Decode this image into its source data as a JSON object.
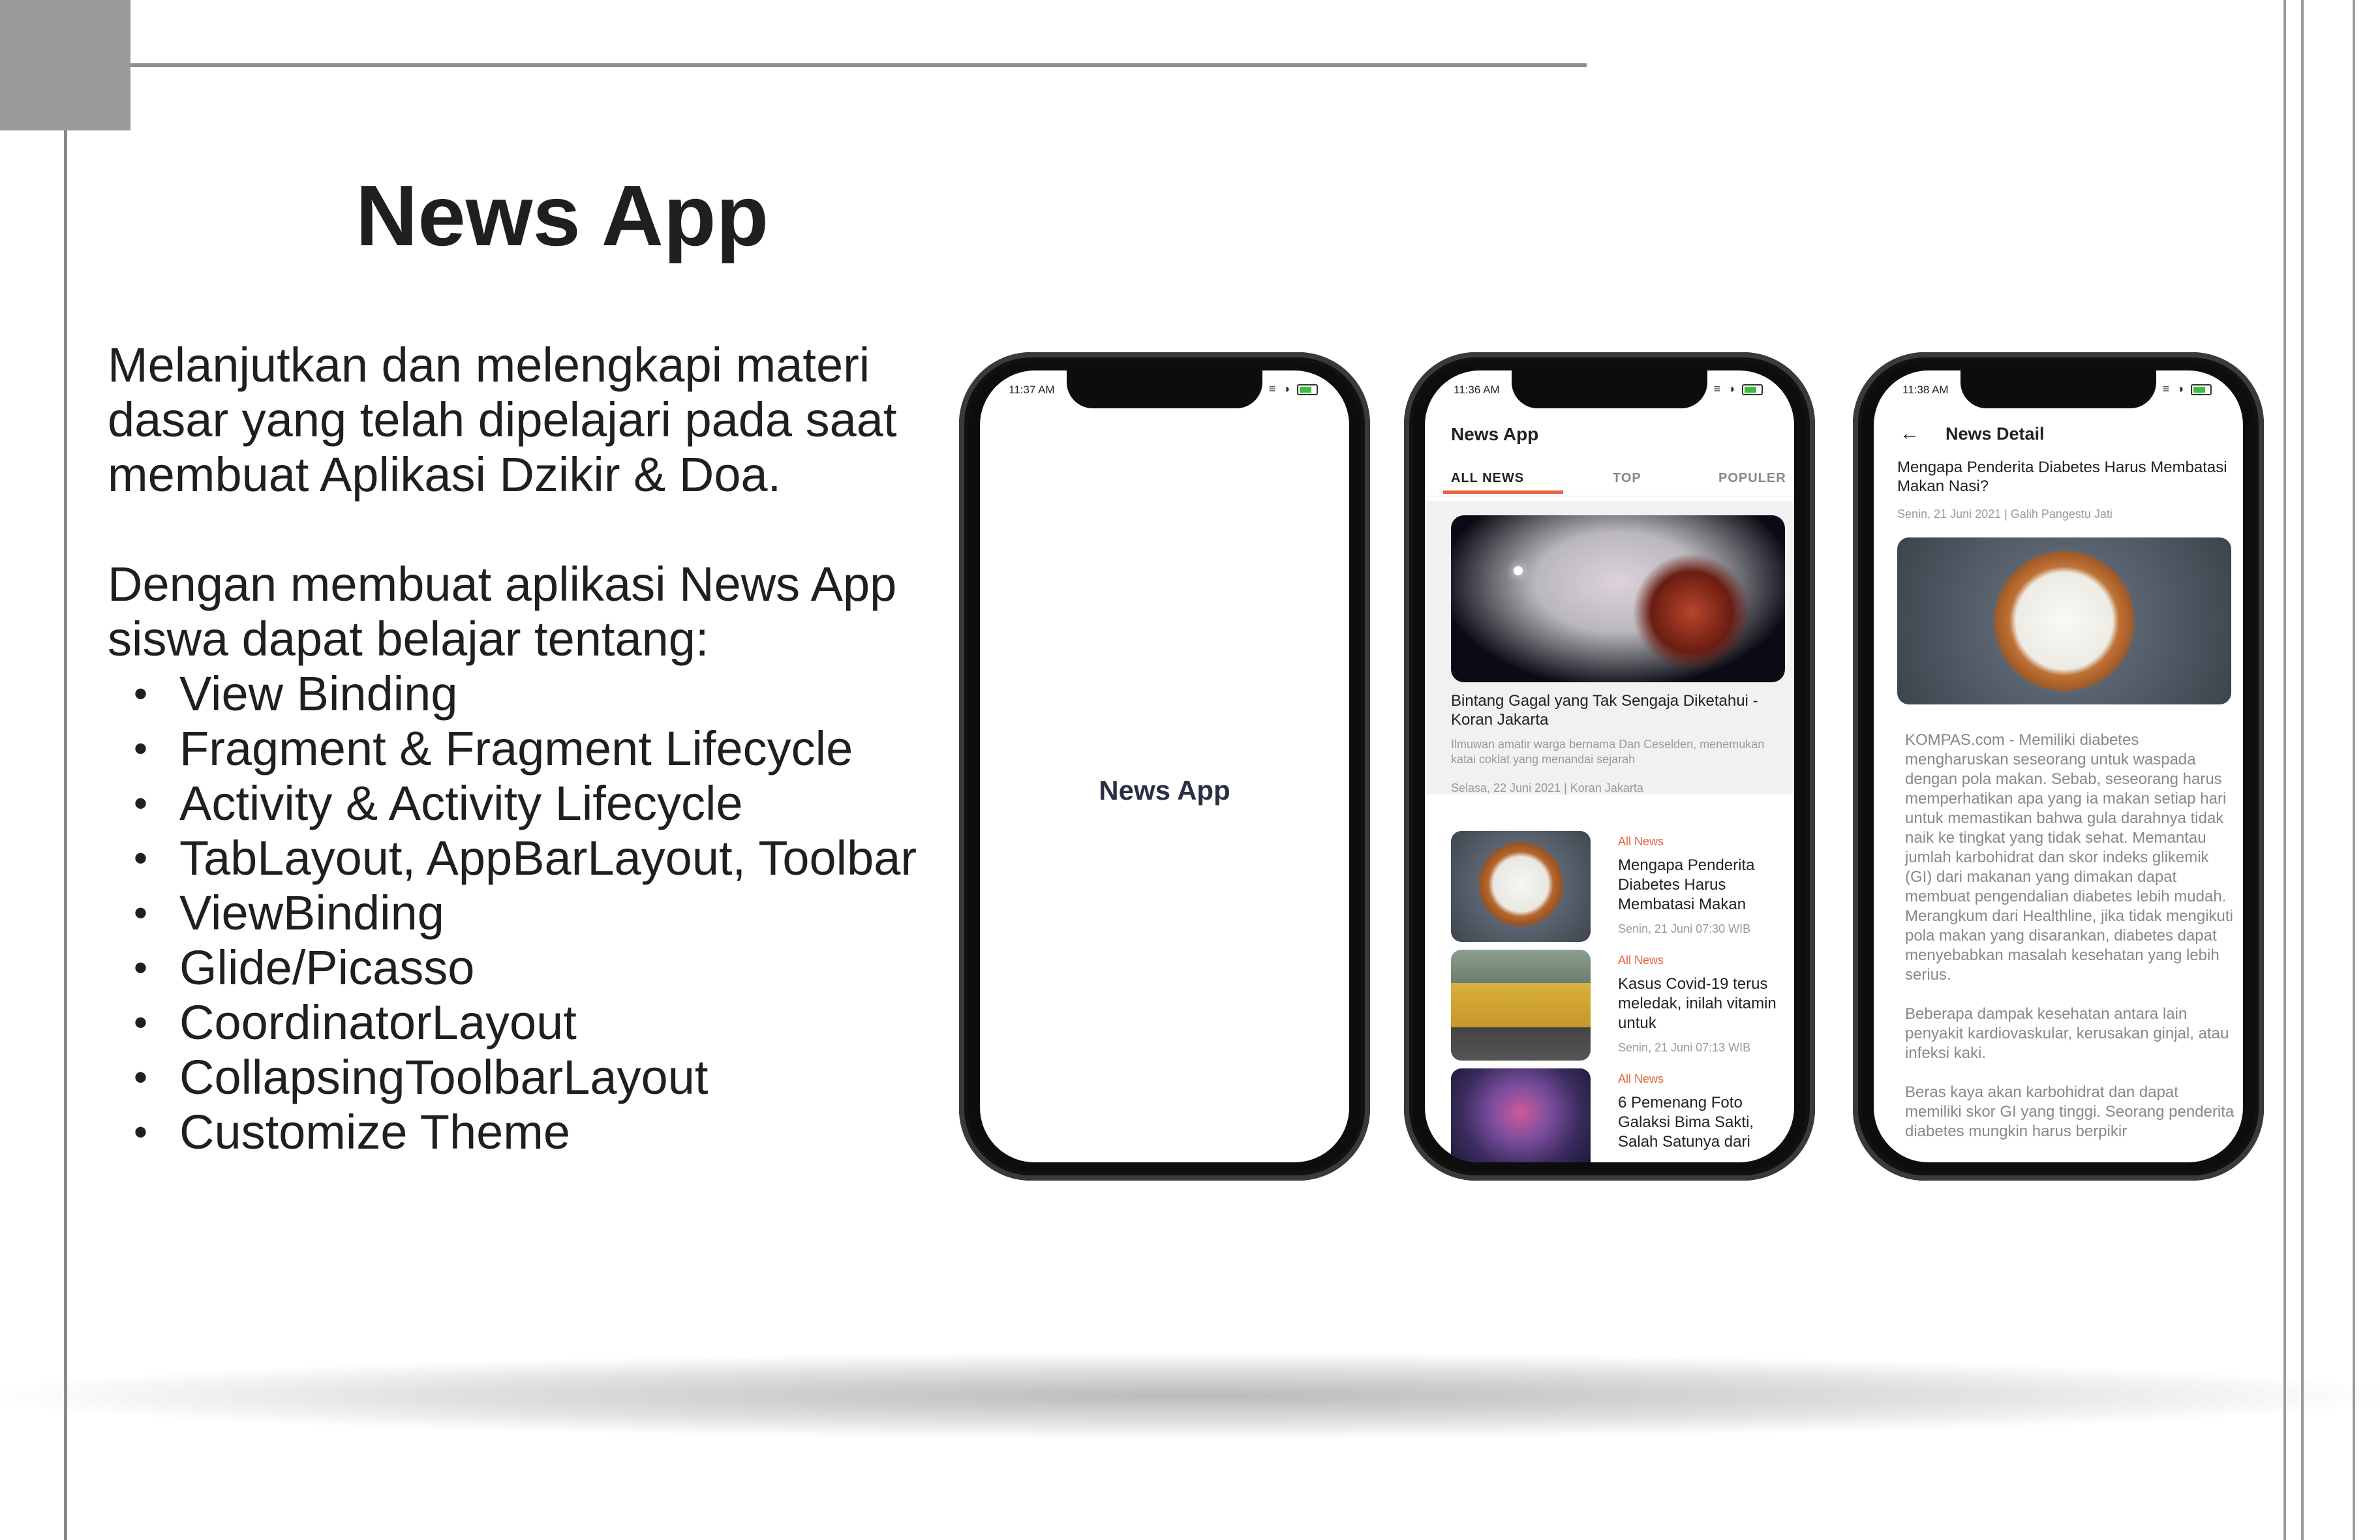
{
  "slide": {
    "title": "News App",
    "paragraph1": "Melanjutkan dan melengkapi materi dasar yang telah dipelajari pada saat membuat Aplikasi Dzikir & Doa.",
    "paragraph2": "Dengan membuat aplikasi News App siswa dapat belajar tentang:",
    "bullet_glyph": "•",
    "bullets": [
      "View Binding",
      "Fragment & Fragment Lifecycle",
      "Activity & Activity Lifecycle",
      "TabLayout, AppBarLayout, Toolbar",
      "ViewBinding",
      "Glide/Picasso",
      "CoordinatorLayout",
      "CollapsingToolbarLayout",
      "Customize Theme"
    ]
  },
  "phone_splash": {
    "time": "11:37 AM",
    "app_name": "News App"
  },
  "phone_list": {
    "time": "11:36 AM",
    "app_title": "News App",
    "tabs": [
      "ALL NEWS",
      "TOP",
      "POPULER"
    ],
    "headline": {
      "title": "Bintang Gagal yang Tak Sengaja Diketahui - Koran Jakarta",
      "description": "Ilmuwan amatir warga bernama Dan Ceselden, menemukan katai coklat yang menandai sejarah",
      "meta": "Selasa, 22 Juni 2021  |  Koran Jakarta"
    },
    "items": [
      {
        "category": "All News",
        "title": "Mengapa Penderita Diabetes Harus Membatasi Makan",
        "meta": "Senin, 21 Juni     07:30 WIB"
      },
      {
        "category": "All News",
        "title": "Kasus Covid-19 terus meledak, inilah vitamin untuk",
        "meta": "Senin, 21 Juni     07:13 WIB"
      },
      {
        "category": "All News",
        "title": "6 Pemenang Foto Galaksi Bima Sakti, Salah Satunya dari",
        "meta": ""
      }
    ]
  },
  "phone_detail": {
    "time": "11:38 AM",
    "back_icon": "←",
    "header": "News Detail",
    "title": "Mengapa Penderita Diabetes Harus Membatasi Makan Nasi?",
    "meta": "Senin, 21 Juni 2021  |  Galih Pangestu Jati",
    "paragraphs": [
      "KOMPAS.com - Memiliki diabetes mengharuskan seseorang untuk waspada dengan pola makan. Sebab, seseorang harus memperhatikan apa yang ia makan setiap hari untuk memastikan bahwa gula darahnya tidak naik ke tingkat yang tidak sehat. Memantau jumlah karbohidrat dan skor indeks glikemik (GI) dari makanan yang dimakan dapat membuat pengendalian diabetes lebih mudah. Merangkum dari Healthline, jika tidak mengikuti pola makan yang disarankan, diabetes dapat menyebabkan masalah kesehatan yang lebih serius.",
      "Beberapa dampak kesehatan antara lain penyakit kardiovaskular, kerusakan ginjal, atau infeksi kaki.",
      "Beras kaya akan karbohidrat dan dapat memiliki skor GI yang tinggi. Seorang penderita diabetes mungkin harus berpikir"
    ]
  },
  "colors": {
    "accent": "#e8603c",
    "text_dark": "#1f1f1f",
    "splash_text": "#2a2f45",
    "rule_gray": "#8f8f8f"
  }
}
